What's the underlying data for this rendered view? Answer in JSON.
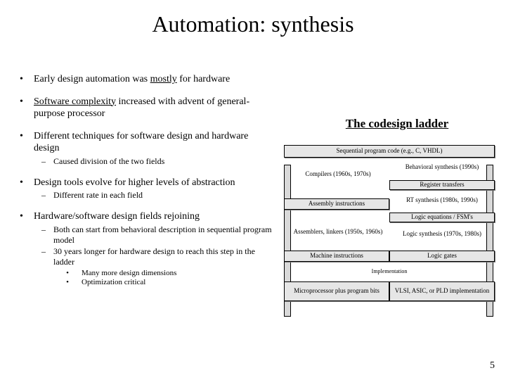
{
  "title": "Automation: synthesis",
  "right_title": "The codesign ladder",
  "page_number": "5",
  "bullets": [
    {
      "text_a": "Early design automation was ",
      "text_u": "mostly",
      "text_b": " for hardware",
      "subs": []
    },
    {
      "text_a": "",
      "text_u": "Software complexity",
      "text_b": " increased with advent of general-purpose processor",
      "subs": []
    },
    {
      "text_a": "Different techniques for software design and hardware design",
      "text_u": "",
      "text_b": "",
      "subs": [
        {
          "text": "Caused division of the two fields",
          "subsubs": []
        }
      ]
    },
    {
      "text_a": "Design tools evolve for higher levels of abstraction",
      "text_u": "",
      "text_b": "",
      "subs": [
        {
          "text": "Different rate in each field",
          "subsubs": []
        }
      ]
    },
    {
      "text_a": "Hardware/software design fields rejoining",
      "text_u": "",
      "text_b": "",
      "subs": [
        {
          "text": "Both can start from behavioral description in sequential program model",
          "subsubs": []
        },
        {
          "text": "30 years longer for hardware design to reach this step in the ladder",
          "subsubs": [
            "Many more design dimensions",
            "Optimization critical"
          ]
        }
      ]
    }
  ],
  "ladder": {
    "rungs": [
      "Sequential program code (e.g., C, VHDL)",
      "Assembly instructions",
      "Machine instructions",
      "Microprocessor plus program bits"
    ],
    "right_rungs": [
      "Register transfers",
      "Logic equations / FSM's",
      "Logic gates",
      "VLSI, ASIC, or PLD implementation"
    ],
    "left_gaps": [
      "Compilers (1960s, 1970s)",
      "",
      "Assemblers, linkers (1950s, 1960s)",
      ""
    ],
    "right_gaps": [
      "Behavioral synthesis (1990s)",
      "RT synthesis (1980s, 1990s)",
      "Logic synthesis (1970s, 1980s)",
      "Implementation"
    ],
    "mid_label": "Implementation"
  }
}
